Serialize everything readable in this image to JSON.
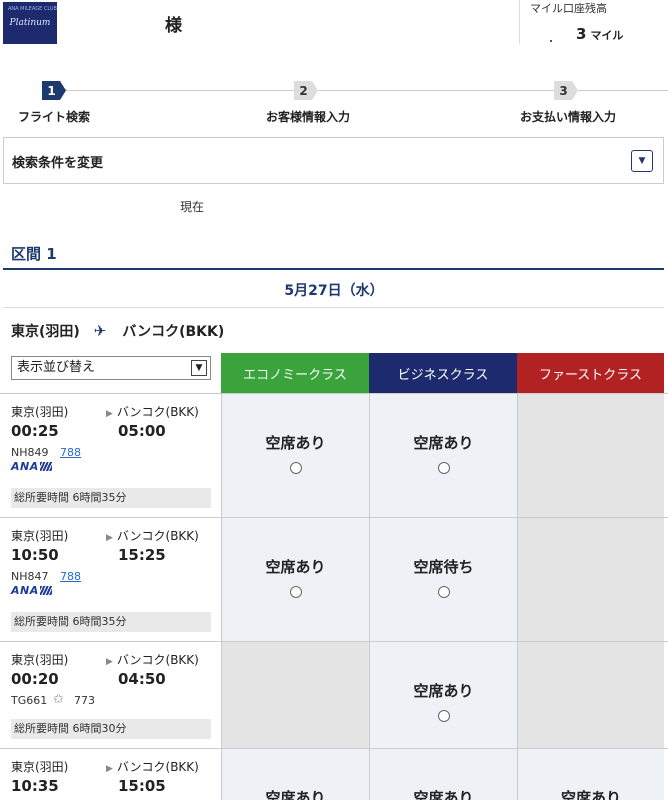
{
  "header": {
    "logo_text": "Platinum",
    "logo_small_text": "ANA MILEAGE CLUB",
    "honorific": "様",
    "miles_label": "マイル口座残高",
    "miles_value": "3",
    "miles_unit": "マイル"
  },
  "stepper": {
    "steps": [
      {
        "num": "1",
        "label": "フライト検索",
        "active": true
      },
      {
        "num": "2",
        "label": "お客様情報入力",
        "active": false
      },
      {
        "num": "3",
        "label": "お支払い情報入力",
        "active": false
      }
    ]
  },
  "search": {
    "title": "検索条件を変更"
  },
  "current_label": "現在",
  "segment": {
    "title": "区間 1"
  },
  "date": "5月27日（水）",
  "route": {
    "from": "東京(羽田)",
    "to": "バンコク(BKK)"
  },
  "sort": {
    "label": "表示並び替え"
  },
  "classes": [
    {
      "label": "エコノミークラス",
      "color": "#3ba33b"
    },
    {
      "label": "ビジネスクラス",
      "color": "#1d2b6e"
    },
    {
      "label": "ファーストクラス",
      "color": "#b22222"
    }
  ],
  "flights": [
    {
      "from": "東京(羽田)",
      "to": "バンコク(BKK)",
      "dep": "00:25",
      "arr": "05:00",
      "flight_no": "NH849",
      "aircraft": "788",
      "carrier_logo": "ANA",
      "duration": "総所要時間 6時間35分",
      "seats": [
        {
          "status": "空席あり",
          "selectable": true
        },
        {
          "status": "空席あり",
          "selectable": true
        },
        {
          "status": "",
          "selectable": false
        }
      ]
    },
    {
      "from": "東京(羽田)",
      "to": "バンコク(BKK)",
      "dep": "10:50",
      "arr": "15:25",
      "flight_no": "NH847",
      "aircraft": "788",
      "carrier_logo": "ANA",
      "duration": "総所要時間 6時間35分",
      "seats": [
        {
          "status": "空席あり",
          "selectable": true
        },
        {
          "status": "空席待ち",
          "selectable": true
        },
        {
          "status": "",
          "selectable": false
        }
      ]
    },
    {
      "from": "東京(羽田)",
      "to": "バンコク(BKK)",
      "dep": "00:20",
      "arr": "04:50",
      "flight_no": "TG661",
      "aircraft": "773",
      "carrier_logo": "star-alliance",
      "duration": "総所要時間 6時間30分",
      "seats": [
        {
          "status": "",
          "selectable": false
        },
        {
          "status": "空席あり",
          "selectable": true
        },
        {
          "status": "",
          "selectable": false
        }
      ]
    },
    {
      "from": "東京(羽田)",
      "to": "バンコク(BKK)",
      "dep": "10:35",
      "arr": "15:05",
      "flight_no": "",
      "aircraft": "",
      "carrier_logo": "",
      "duration": "",
      "seats": [
        {
          "status": "空席あり",
          "selectable": true
        },
        {
          "status": "空席あり",
          "selectable": true
        },
        {
          "status": "空席あり",
          "selectable": true
        }
      ]
    }
  ]
}
